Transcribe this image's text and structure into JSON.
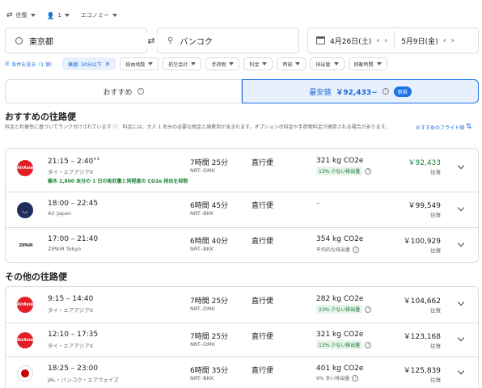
{
  "search": {
    "trip_type": "往復",
    "passengers": "1",
    "cabin": "エコノミー",
    "origin": "東京都",
    "destination": "バンコク",
    "depart_date": "4月26日(土)",
    "return_date": "5月9日(金)"
  },
  "filters": {
    "all_filters_label": "条件を見る（1 個）",
    "chips": [
      "乗継: 30分以下",
      "経由地数",
      "航空会社",
      "手荷物",
      "料金",
      "時刻",
      "排出量",
      "移動時間"
    ]
  },
  "sort_tabs": {
    "best_label": "おすすめ",
    "cheapest_label": "最安値",
    "cheapest_price": "￥92,433~",
    "new_badge": "新規"
  },
  "best_section": {
    "title": "おすすめの往路便",
    "note": "料金と利便性に基づいてランク付けされています ⓘ　料金には、大人 1 名分の必要な税金と諸費用が含まれます。オプションの料金や手荷物料金が適用される場合があります。",
    "sort_link": "おすすめのフライト順"
  },
  "other_section": {
    "title": "その他の往路便"
  },
  "flights": [
    {
      "times": "21:15 – 2:40",
      "plus": "+1",
      "airline": "タイ・エアアジアX",
      "duration": "7時間 25分",
      "route": "NRT–DMK",
      "stops": "直行便",
      "co2": "321 kg CO2e",
      "emission": "13% 少ない排出量",
      "price": "￥92,433",
      "price_type": "往復",
      "eco_note": "樹木 2,800 本分の 1 日の吸収量と同程度の CO2e 排出を抑制"
    },
    {
      "times": "18:00 – 22:45",
      "plus": "",
      "airline": "Air Japan",
      "duration": "6時間 45分",
      "route": "NRT–BKK",
      "stops": "直行便",
      "co2": "–",
      "emission": "",
      "price": "￥99,549",
      "price_type": "往復",
      "eco_note": ""
    },
    {
      "times": "17:00 – 21:40",
      "plus": "",
      "airline": "ZIPAIR Tokyo",
      "duration": "6時間 40分",
      "route": "NRT–BKK",
      "stops": "直行便",
      "co2": "354 kg CO2e",
      "emission": "平均的な排出量",
      "price": "￥100,929",
      "price_type": "往復",
      "eco_note": ""
    },
    {
      "times": "9:15 – 14:40",
      "plus": "",
      "airline": "タイ・エアアジアX",
      "duration": "7時間 25分",
      "route": "NRT–DMK",
      "stops": "直行便",
      "co2": "282 kg CO2e",
      "emission": "23% 少ない排出量",
      "price": "￥104,662",
      "price_type": "往復",
      "eco_note": ""
    },
    {
      "times": "12:10 – 17:35",
      "plus": "",
      "airline": "タイ・エアアジアX",
      "duration": "7時間 25分",
      "route": "NRT–DMK",
      "stops": "直行便",
      "co2": "321 kg CO2e",
      "emission": "13% 少ない排出量",
      "price": "￥123,168",
      "price_type": "往復",
      "eco_note": ""
    },
    {
      "times": "18:25 – 23:00",
      "plus": "",
      "airline": "JAL・バンコク・エアウェイズ",
      "duration": "6時間 35分",
      "route": "NRT–BKK",
      "stops": "直行便",
      "co2": "401 kg CO2e",
      "emission": "9% 多い排出量",
      "price": "￥125,839",
      "price_type": "往復",
      "eco_note": ""
    }
  ],
  "logos": {
    "airasia": "AirAsia",
    "airjapan": "◡",
    "zipair": "ZIPAIR"
  },
  "colors": {
    "accent": "#1a73e8",
    "green": "#188038",
    "airasia_red": "#e31e26"
  }
}
